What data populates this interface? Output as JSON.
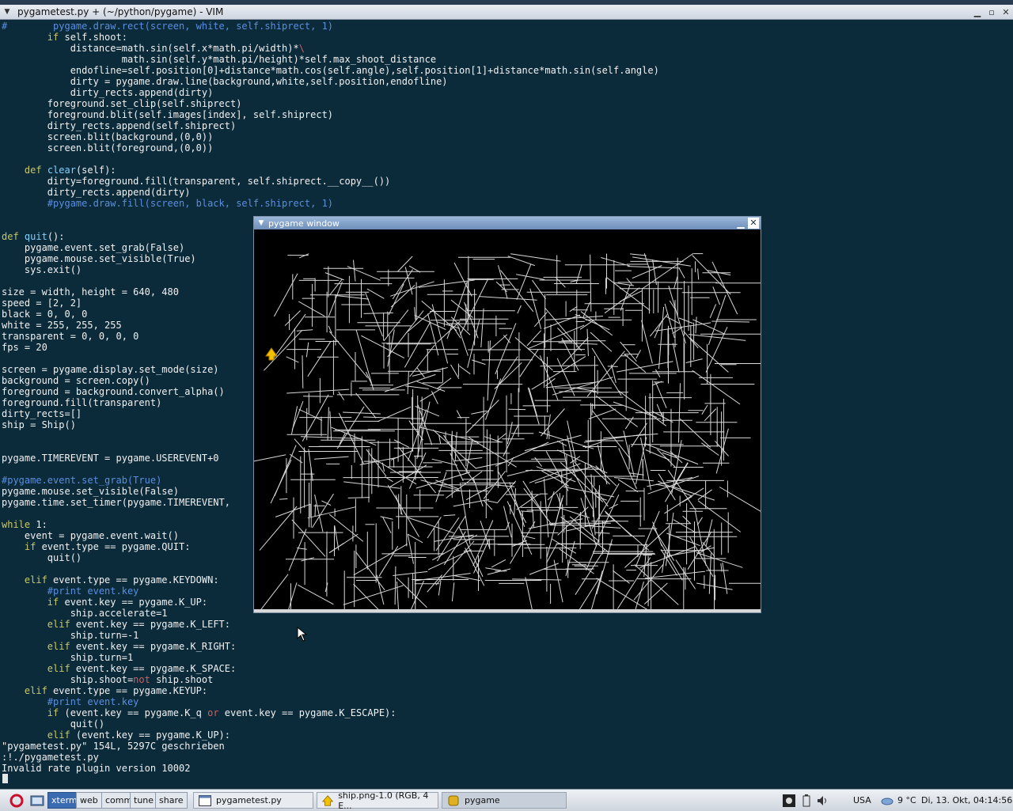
{
  "vim_window": {
    "title": "pygametest.py + (~/python/pygame) - VIM",
    "code_lines": [
      [
        {
          "t": "#        pygame.draw.rect(screen, white, self.shiprect, 1)",
          "c": "cm"
        }
      ],
      [
        {
          "t": "        "
        },
        {
          "t": "if",
          "c": "kw"
        },
        {
          "t": " self.shoot:"
        }
      ],
      [
        {
          "t": "            distance=math.sin(self.x*math.pi/width)*"
        },
        {
          "t": "\\",
          "c": "wrap"
        }
      ],
      [
        {
          "t": "                     math.sin(self.y*math.pi/height)*self.max_shoot_distance"
        }
      ],
      [
        {
          "t": "            endofline=self.position[0]+distance*math.cos(self.angle),self.position[1]+distance*math.sin(self.angle)"
        }
      ],
      [
        {
          "t": "            dirty = pygame.draw.line(background,white,self.position,endofline)"
        }
      ],
      [
        {
          "t": "            dirty_rects.append(dirty)"
        }
      ],
      [
        {
          "t": "        foreground.set_clip(self.shiprect)"
        }
      ],
      [
        {
          "t": "        foreground.blit(self.images[index], self.shiprect)"
        }
      ],
      [
        {
          "t": "        dirty_rects.append(self.shiprect)"
        }
      ],
      [
        {
          "t": "        screen.blit(background,(0,0))"
        }
      ],
      [
        {
          "t": "        screen.blit(foreground,(0,0))"
        }
      ],
      [
        {
          "t": ""
        }
      ],
      [
        {
          "t": "    "
        },
        {
          "t": "def",
          "c": "kw"
        },
        {
          "t": " "
        },
        {
          "t": "clear",
          "c": "fn"
        },
        {
          "t": "(self):"
        }
      ],
      [
        {
          "t": "        dirty=foreground.fill(transparent, self.shiprect.__copy__())"
        }
      ],
      [
        {
          "t": "        dirty_rects.append(dirty)"
        }
      ],
      [
        {
          "t": "        #pygame.draw.fill(screen, black, self.shiprect, 1)",
          "c": "cm"
        }
      ],
      [
        {
          "t": ""
        }
      ],
      [
        {
          "t": ""
        }
      ],
      [
        {
          "t": "def",
          "c": "kw"
        },
        {
          "t": " "
        },
        {
          "t": "quit",
          "c": "fn"
        },
        {
          "t": "():"
        }
      ],
      [
        {
          "t": "    pygame.event.set_grab(False)"
        }
      ],
      [
        {
          "t": "    pygame.mouse.set_visible(True)"
        }
      ],
      [
        {
          "t": "    sys.exit()"
        }
      ],
      [
        {
          "t": ""
        }
      ],
      [
        {
          "t": "size = width, height = 640, 480"
        }
      ],
      [
        {
          "t": "speed = [2, 2]"
        }
      ],
      [
        {
          "t": "black = 0, 0, 0"
        }
      ],
      [
        {
          "t": "white = 255, 255, 255"
        }
      ],
      [
        {
          "t": "transparent = 0, 0, 0, 0"
        }
      ],
      [
        {
          "t": "fps = 20"
        }
      ],
      [
        {
          "t": ""
        }
      ],
      [
        {
          "t": "screen = pygame.display.set_mode(size)"
        }
      ],
      [
        {
          "t": "background = screen.copy()"
        }
      ],
      [
        {
          "t": "foreground = background.convert_alpha()"
        }
      ],
      [
        {
          "t": "foreground.fill(transparent)"
        }
      ],
      [
        {
          "t": "dirty_rects=[]"
        }
      ],
      [
        {
          "t": "ship = Ship()"
        }
      ],
      [
        {
          "t": ""
        }
      ],
      [
        {
          "t": ""
        }
      ],
      [
        {
          "t": "pygame.TIMEREVENT = pygame.USEREVENT+0"
        }
      ],
      [
        {
          "t": ""
        }
      ],
      [
        {
          "t": "#pygame.event.set_grab(True)",
          "c": "cm"
        }
      ],
      [
        {
          "t": "pygame.mouse.set_visible(False)"
        }
      ],
      [
        {
          "t": "pygame.time.set_timer(pygame.TIMEREVENT,"
        }
      ],
      [
        {
          "t": ""
        }
      ],
      [
        {
          "t": "while",
          "c": "kw"
        },
        {
          "t": " 1:"
        }
      ],
      [
        {
          "t": "    event = pygame.event.wait()"
        }
      ],
      [
        {
          "t": "    "
        },
        {
          "t": "if",
          "c": "kw"
        },
        {
          "t": " event.type == pygame.QUIT:"
        }
      ],
      [
        {
          "t": "        quit()"
        }
      ],
      [
        {
          "t": ""
        }
      ],
      [
        {
          "t": "    "
        },
        {
          "t": "elif",
          "c": "kw"
        },
        {
          "t": " event.type == pygame.KEYDOWN:"
        }
      ],
      [
        {
          "t": "        #print event.key",
          "c": "cm"
        }
      ],
      [
        {
          "t": "        "
        },
        {
          "t": "if",
          "c": "kw"
        },
        {
          "t": " event.key == pygame.K_UP:"
        }
      ],
      [
        {
          "t": "            ship.accelerate=1"
        }
      ],
      [
        {
          "t": "        "
        },
        {
          "t": "elif",
          "c": "kw"
        },
        {
          "t": " event.key == pygame.K_LEFT:"
        }
      ],
      [
        {
          "t": "            ship.turn=-1"
        }
      ],
      [
        {
          "t": "        "
        },
        {
          "t": "elif",
          "c": "kw"
        },
        {
          "t": " event.key == pygame.K_RIGHT:"
        }
      ],
      [
        {
          "t": "            ship.turn=1"
        }
      ],
      [
        {
          "t": "        "
        },
        {
          "t": "elif",
          "c": "kw"
        },
        {
          "t": " event.key == pygame.K_SPACE:"
        }
      ],
      [
        {
          "t": "            ship.shoot="
        },
        {
          "t": "not",
          "c": "wrap"
        },
        {
          "t": " ship.shoot"
        }
      ],
      [
        {
          "t": "    "
        },
        {
          "t": "elif",
          "c": "kw"
        },
        {
          "t": " event.type == pygame.KEYUP:"
        }
      ],
      [
        {
          "t": "        #print event.key",
          "c": "cm"
        }
      ],
      [
        {
          "t": "        "
        },
        {
          "t": "if",
          "c": "kw"
        },
        {
          "t": " (event.key == pygame.K_q "
        },
        {
          "t": "or",
          "c": "wrap"
        },
        {
          "t": " event.key == pygame.K_ESCAPE):"
        }
      ],
      [
        {
          "t": "            quit()"
        }
      ],
      [
        {
          "t": "        "
        },
        {
          "t": "elif",
          "c": "kw"
        },
        {
          "t": " (event.key == pygame.K_UP):"
        }
      ]
    ],
    "status_lines": [
      "\"pygametest.py\" 154L, 5297C geschrieben",
      ":!./pygametest.py",
      "Invalid rate plugin version 10002"
    ]
  },
  "pygame_window": {
    "title": "pygame window",
    "minimize_glyph": "▁",
    "close_glyph": "✕"
  },
  "taskbar": {
    "workspaces": [
      "xterm",
      "web",
      "comm",
      "tune",
      "share"
    ],
    "active_workspace": "xterm",
    "tasks": [
      {
        "label": "pygametest.py",
        "icon": "terminal-icon"
      },
      {
        "label": "ship.png-1.0 (RGB, 4 E...",
        "icon": "gimp-icon"
      },
      {
        "label": "pygame",
        "icon": "python-icon"
      }
    ],
    "keyboard_layout": "USA",
    "temperature": "9 °C",
    "clock": "Di, 13. Okt, 04:14:56"
  },
  "colors": {
    "terminal_bg": "#0b2a3a",
    "keyword": "#c8c86a",
    "function": "#7fd3ff",
    "comment": "#5a8fe0"
  }
}
